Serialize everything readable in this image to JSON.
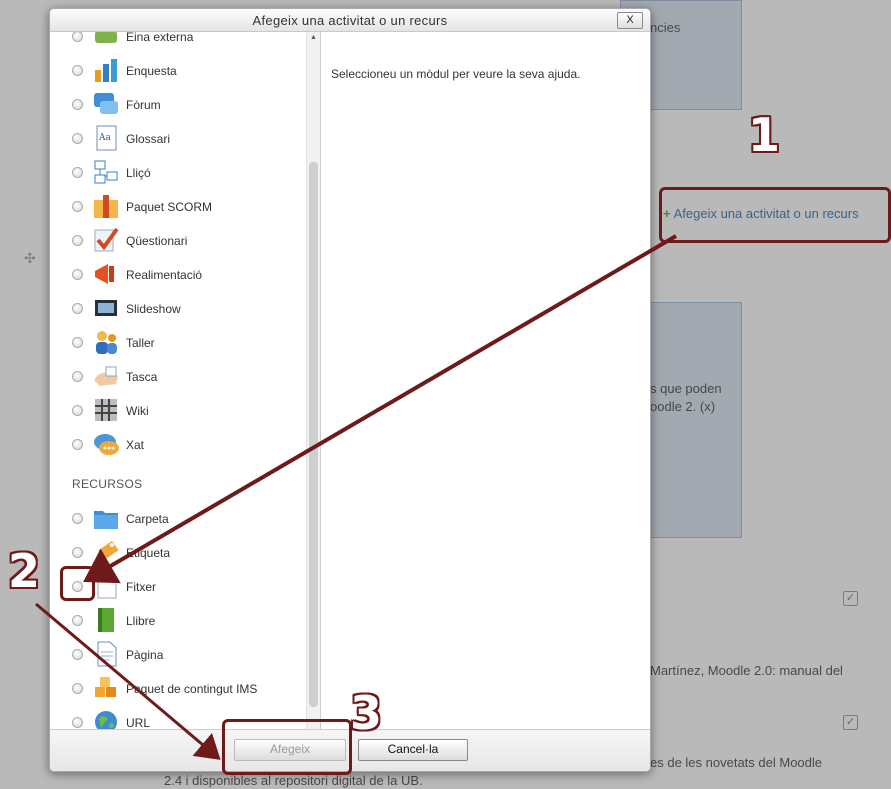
{
  "dialog": {
    "title": "Afegeix una activitat o un recurs",
    "close_label": "X",
    "help_text": "Seleccioneu un mòdul per veure la seva ajuda.",
    "add_button": "Afegeix",
    "cancel_button": "Cancel·la"
  },
  "activities": [
    {
      "label": "Eina externa",
      "icon": "puzzle-icon"
    },
    {
      "label": "Enquesta",
      "icon": "bar-chart-icon"
    },
    {
      "label": "Fòrum",
      "icon": "forum-icon"
    },
    {
      "label": "Glossari",
      "icon": "glossary-icon"
    },
    {
      "label": "Lliçó",
      "icon": "lesson-icon"
    },
    {
      "label": "Paquet SCORM",
      "icon": "package-icon"
    },
    {
      "label": "Qüestionari",
      "icon": "quiz-icon"
    },
    {
      "label": "Realimentació",
      "icon": "megaphone-icon"
    },
    {
      "label": "Slideshow",
      "icon": "slideshow-icon"
    },
    {
      "label": "Taller",
      "icon": "workshop-icon"
    },
    {
      "label": "Tasca",
      "icon": "assignment-icon"
    },
    {
      "label": "Wiki",
      "icon": "wiki-icon"
    },
    {
      "label": "Xat",
      "icon": "chat-icon"
    }
  ],
  "resources_heading": "RECURSOS",
  "resources": [
    {
      "label": "Carpeta",
      "icon": "folder-icon"
    },
    {
      "label": "Etiqueta",
      "icon": "label-icon"
    },
    {
      "label": "Fitxer",
      "icon": "file-icon"
    },
    {
      "label": "Llibre",
      "icon": "book-icon"
    },
    {
      "label": "Pàgina",
      "icon": "page-icon"
    },
    {
      "label": "Paquet de contingut IMS",
      "icon": "ims-package-icon"
    },
    {
      "label": "URL",
      "icon": "url-globe-icon"
    }
  ],
  "background": {
    "top_fragment": "ncies",
    "add_link": "Afegeix una activitat o un recurs",
    "para_line1": "s que poden",
    "para_line2": "oodle 2. (x)",
    "ref_line": "Martínez, Moodle 2.0: manual del",
    "bottom_line1": "es de les novetats del Moodle",
    "bottom_line2": "2.4 i disponibles al repositori digital de la UB."
  },
  "annotations": {
    "step1": "1",
    "step2": "2",
    "step3": "3",
    "arrow_color": "#6e1a1a"
  }
}
